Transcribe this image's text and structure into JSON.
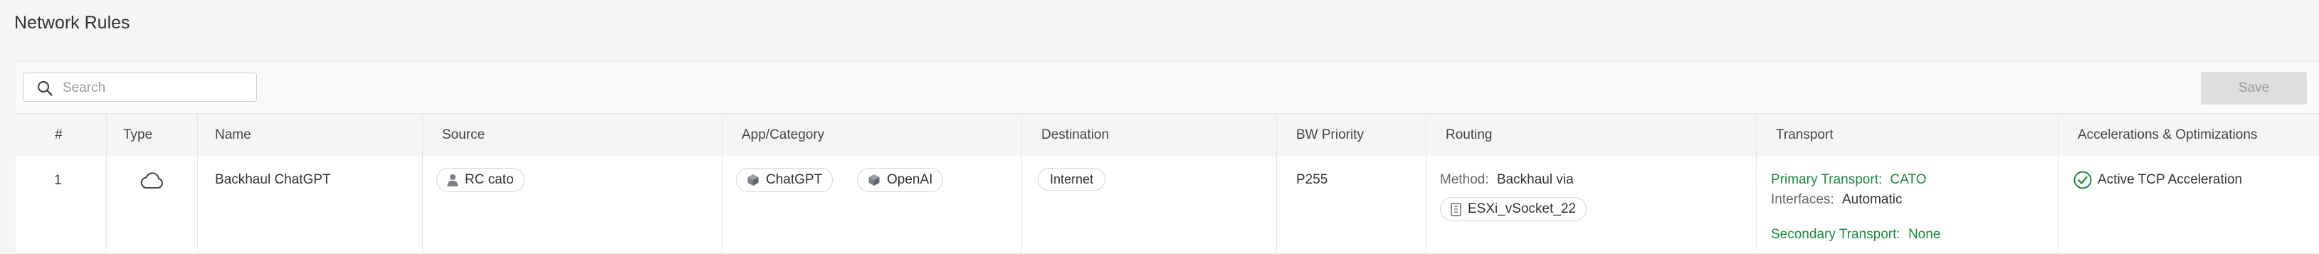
{
  "page": {
    "title": "Network Rules"
  },
  "toolbar": {
    "search_placeholder": "Search",
    "search_value": "",
    "save_label": "Save"
  },
  "colors": {
    "accent_green": "#1a8a3e",
    "icon_gray": "#7a8089",
    "header_bg": "#f5f5f5"
  },
  "table": {
    "columns": [
      "#",
      "Type",
      "Name",
      "Source",
      "App/Category",
      "Destination",
      "BW Priority",
      "Routing",
      "Transport",
      "Accelerations & Optimizations"
    ],
    "rows": [
      {
        "index": "1",
        "type_icon": "cloud-icon",
        "name": "Backhaul ChatGPT",
        "source": {
          "icon": "user-icon",
          "label": "RC cato"
        },
        "apps": [
          {
            "icon": "cube-icon",
            "label": "ChatGPT"
          },
          {
            "icon": "cube-icon",
            "label": "OpenAI"
          }
        ],
        "destination": "Internet",
        "bw_priority": "P255",
        "routing": {
          "method_label": "Method:",
          "method_value": "Backhaul via",
          "target_icon": "server-icon",
          "target": "ESXi_vSocket_22"
        },
        "transport": {
          "primary_label": "Primary Transport:",
          "primary_value": "CATO",
          "interfaces_label": "Interfaces:",
          "interfaces_value": "Automatic",
          "secondary_label": "Secondary Transport:",
          "secondary_value": "None"
        },
        "acceleration": {
          "icon": "check-circle-icon",
          "label": "Active TCP Acceleration"
        }
      }
    ]
  }
}
